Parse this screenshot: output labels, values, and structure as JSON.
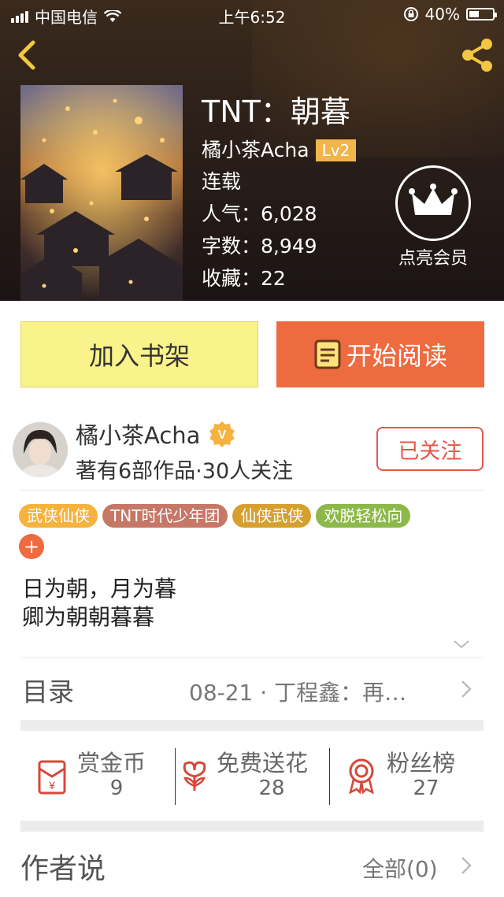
{
  "status_bar": {
    "carrier": "中国电信",
    "time": "上午6:52",
    "battery": "40%"
  },
  "book": {
    "title": "TNT：朝暮",
    "author": "橘小茶Acha",
    "author_level": "Lv2",
    "status": "连载",
    "popularity": "人气：6,028",
    "word_count": "字数：8,949",
    "favorites": "收藏：22"
  },
  "vip": {
    "label": "点亮会员"
  },
  "actions": {
    "add_to_shelf": "加入书架",
    "start_reading": "开始阅读"
  },
  "author_card": {
    "name": "橘小茶Acha",
    "verified_badge": "V",
    "stats": "著有6部作品·30人关注",
    "follow_label": "已关注"
  },
  "tags": [
    {
      "label": "武侠仙侠",
      "color": "#f5b23d"
    },
    {
      "label": "TNT时代少年团",
      "color": "#c67766"
    },
    {
      "label": "仙侠武侠",
      "color": "#d6a02f"
    },
    {
      "label": "欢脱轻松向",
      "color": "#8db84a"
    }
  ],
  "tag_add": "+",
  "description": [
    "日为朝，月为暮",
    "卿为朝朝暮暮"
  ],
  "toc": {
    "label": "目录",
    "latest": "08-21 · 丁程鑫：再…"
  },
  "stats": {
    "reward": {
      "label": "赏金币",
      "value": "9"
    },
    "flowers": {
      "label": "免费送花",
      "value": "28"
    },
    "fans": {
      "label": "粉丝榜",
      "value": "27"
    }
  },
  "author_says": {
    "label": "作者说",
    "all": "全部(0)"
  },
  "colors": {
    "accent": "#ee6a3f",
    "shelf_button": "#faf28a",
    "follow": "#e5564a",
    "level_badge": "#f0b64a"
  },
  "icons": [
    "signal-icon",
    "wifi-icon",
    "lock-rotation-icon",
    "battery-icon",
    "back-icon",
    "share-icon",
    "crown-icon",
    "book-icon",
    "verified-badge-icon",
    "chevron-down-icon",
    "chevron-right-icon",
    "red-envelope-icon",
    "flower-icon",
    "medal-icon"
  ]
}
